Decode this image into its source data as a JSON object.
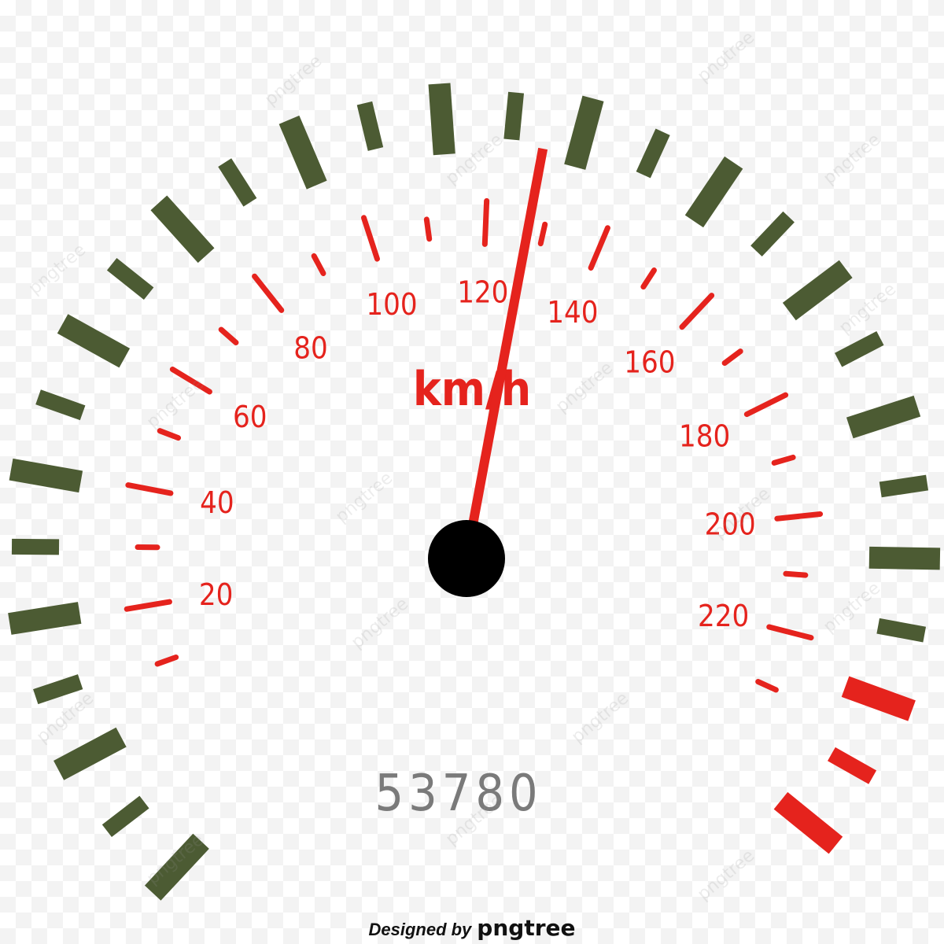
{
  "gauge": {
    "unit": "km/h",
    "speed_labels": [
      "20",
      "40",
      "60",
      "80",
      "100",
      "120",
      "140",
      "160",
      "180",
      "200",
      "220"
    ],
    "needle_speed": 128,
    "odometer": "53780",
    "colors": {
      "outer_tick": "#4c5b33",
      "redline_tick": "#e5231d",
      "scale": "#e5231d",
      "needle": "#e5231d",
      "hub": "#000000",
      "odometer": "#7a7a7a"
    }
  },
  "credit": {
    "designed_by": "Designed by",
    "brand": "pngtree"
  },
  "watermark": "pngtree"
}
